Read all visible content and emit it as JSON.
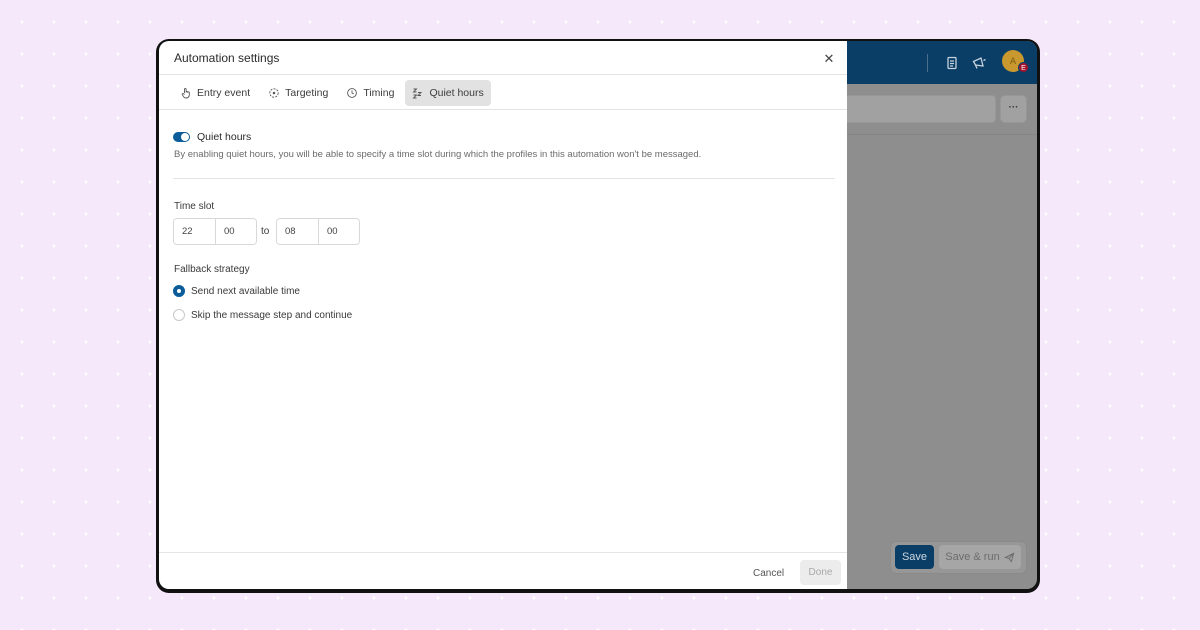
{
  "colors": {
    "page_bg": "#f5e8fb",
    "app_header": "#0b3e66",
    "accent": "#0b5c99",
    "overlay": "#8e8e8e"
  },
  "modal": {
    "title": "Automation settings",
    "close_icon": "close-icon",
    "tabs": [
      {
        "label": "Entry event",
        "icon": "hand-pointer-icon",
        "active": false
      },
      {
        "label": "Targeting",
        "icon": "crosshair-icon",
        "active": false
      },
      {
        "label": "Timing",
        "icon": "clock-icon",
        "active": false
      },
      {
        "label": "Quiet hours",
        "icon": "zzz-icon",
        "active": true
      }
    ],
    "quiet_hours": {
      "toggle_label": "Quiet hours",
      "enabled": true,
      "description": "By enabling quiet hours, you will be able to specify a time slot during which the profiles in this automation won't be messaged."
    },
    "time_slot": {
      "label": "Time slot",
      "start_hour": "22",
      "start_minute": "00",
      "separator": "to",
      "end_hour": "08",
      "end_minute": "00"
    },
    "fallback": {
      "label": "Fallback strategy",
      "options": [
        {
          "label": "Send next available time",
          "selected": true
        },
        {
          "label": "Skip the message step and continue",
          "selected": false
        }
      ]
    },
    "footer": {
      "cancel_label": "Cancel",
      "done_label": "Done"
    }
  },
  "background_app": {
    "header_icons": [
      "document-icon",
      "megaphone-icon"
    ],
    "avatar_initial": "A",
    "avatar_badge": "E",
    "more_label": "···",
    "save_label": "Save",
    "save_run_label": "Save & run"
  }
}
